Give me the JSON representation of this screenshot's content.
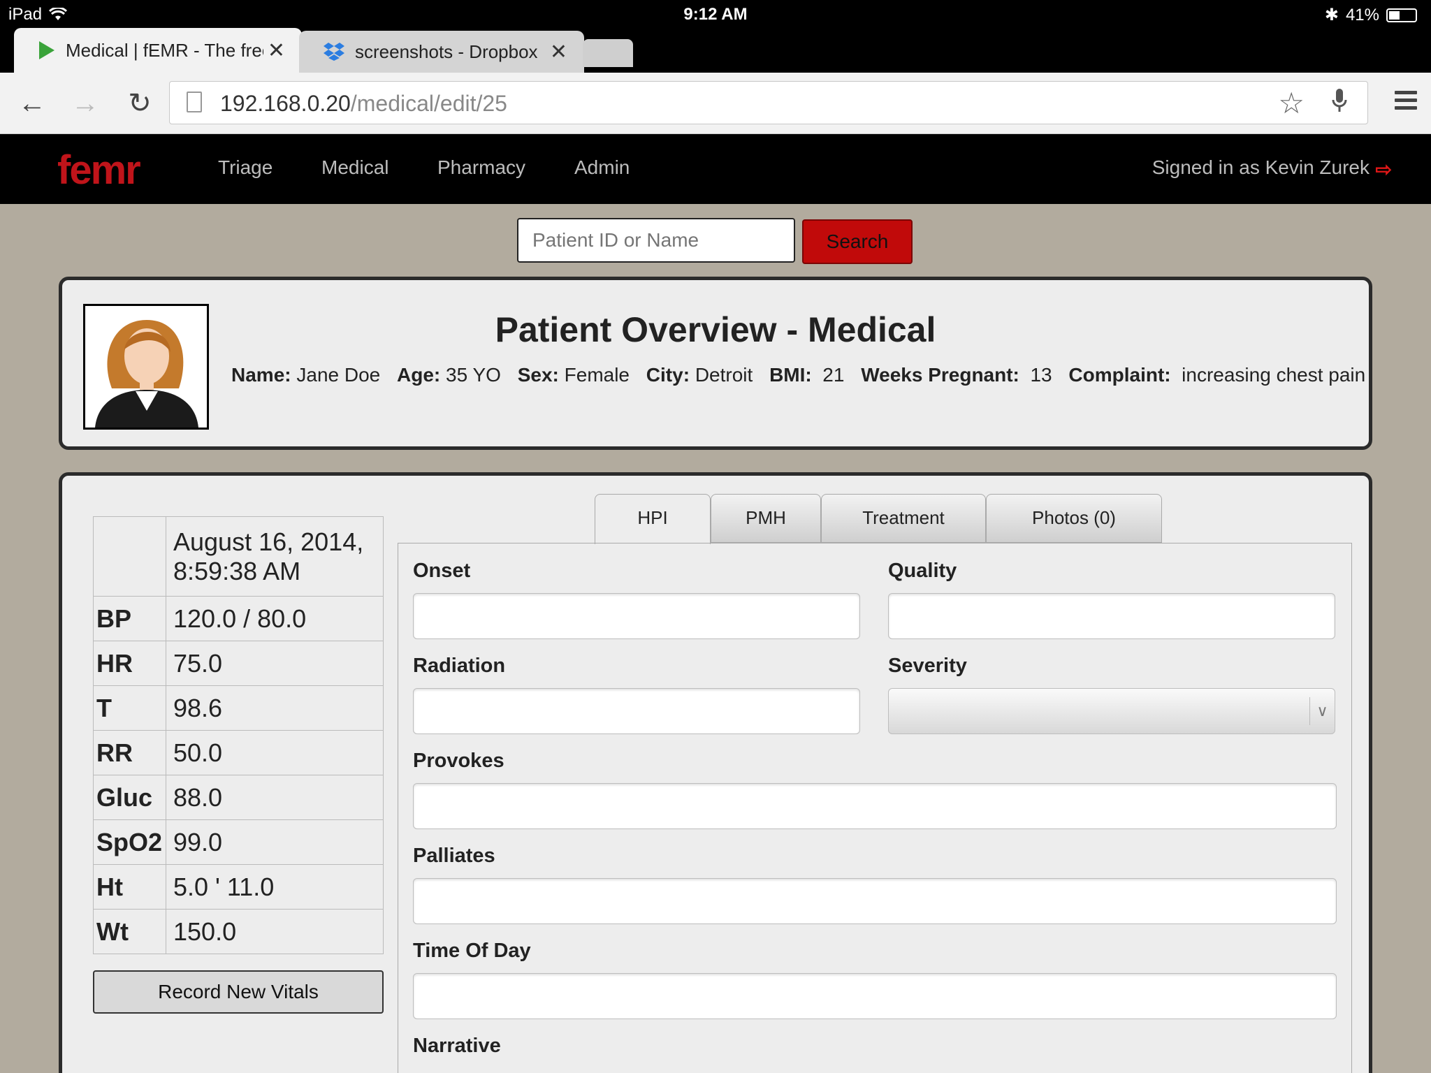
{
  "status_bar": {
    "device": "iPad",
    "time": "9:12 AM",
    "battery": "41%",
    "battery_level": 0.41
  },
  "browser": {
    "tabs": [
      {
        "title": "Medical | fEMR - The free",
        "active": true
      },
      {
        "title": "screenshots - Dropbox",
        "active": false
      }
    ],
    "url_host": "192.168.0.20",
    "url_path": "/medical/edit/25"
  },
  "nav": {
    "logo": "femr",
    "links": [
      "Triage",
      "Medical",
      "Pharmacy",
      "Admin"
    ],
    "signed_in": "Signed in as Kevin Zurek"
  },
  "search": {
    "placeholder": "Patient ID or Name",
    "button": "Search"
  },
  "overview": {
    "title": "Patient Overview - Medical",
    "fields": [
      {
        "label": "Name:",
        "value": "Jane Doe"
      },
      {
        "label": "Age:",
        "value": "35 YO"
      },
      {
        "label": "Sex:",
        "value": "Female"
      },
      {
        "label": "City:",
        "value": "Detroit"
      },
      {
        "label": "BMI:",
        "value": "21"
      },
      {
        "label": "Weeks Pregnant:",
        "value": "13"
      },
      {
        "label": "Complaint:",
        "value": "increasing chest pain"
      }
    ]
  },
  "vitals": {
    "date_line1": "August 16, 2014,",
    "date_line2": "8:59:38 AM",
    "rows": [
      {
        "label": "BP",
        "value": "120.0 / 80.0"
      },
      {
        "label": "HR",
        "value": "75.0"
      },
      {
        "label": "T",
        "value": "98.6"
      },
      {
        "label": "RR",
        "value": "50.0"
      },
      {
        "label": "Gluc",
        "value": "88.0"
      },
      {
        "label": "SpO2",
        "value": "99.0"
      },
      {
        "label": "Ht",
        "value": "5.0 ' 11.0"
      },
      {
        "label": "Wt",
        "value": "150.0"
      }
    ],
    "record_button": "Record New Vitals"
  },
  "tabs": [
    "HPI",
    "PMH",
    "Treatment",
    "Photos (0)"
  ],
  "hpi": {
    "onset": "Onset",
    "quality": "Quality",
    "radiation": "Radiation",
    "severity": "Severity",
    "provokes": "Provokes",
    "palliates": "Palliates",
    "time_of_day": "Time Of Day",
    "narrative": "Narrative"
  }
}
